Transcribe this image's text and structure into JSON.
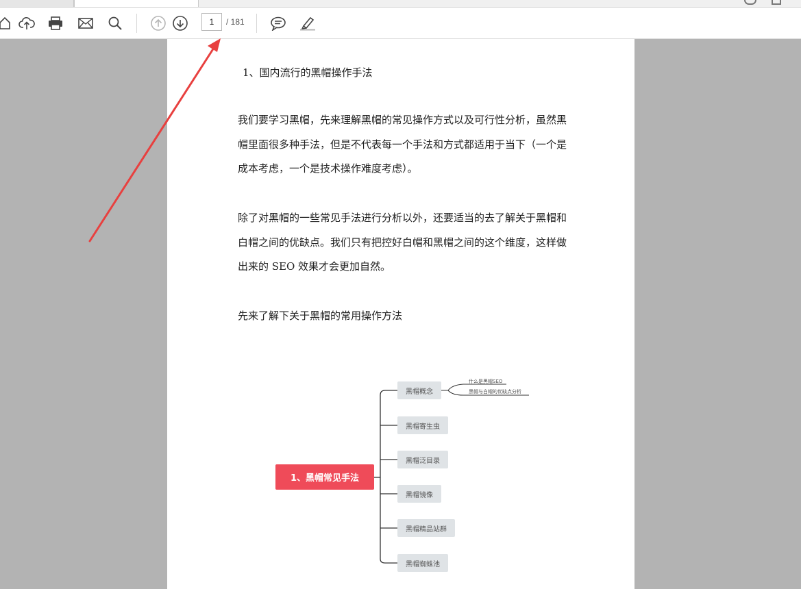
{
  "toolbar": {
    "page_input_value": "1",
    "page_total": "/ 181"
  },
  "document": {
    "heading": "1、国内流行的黑帽操作手法",
    "paragraphs": [
      "我们要学习黑帽，先来理解黑帽的常见操作方式以及可行性分析，虽然黑帽里面很多种手法，但是不代表每一个手法和方式都适用于当下（一个是成本考虑，一个是技术操作难度考虑）。",
      "除了对黑帽的一些常见手法进行分析以外，还要适当的去了解关于黑帽和白帽之间的优缺点。我们只有把控好白帽和黑帽之间的这个维度，这样做出来的 SEO 效果才会更加自然。",
      "先来了解下关于黑帽的常用操作方法"
    ]
  },
  "mindmap": {
    "root": "1、黑帽常见手法",
    "branches": [
      "黑帽概念",
      "黑帽寄生虫",
      "黑帽泛目录",
      "黑帽镜像",
      "黑帽精品站群",
      "黑帽蜘蛛池"
    ],
    "sub_items": [
      "什么是黑帽SEO",
      "黑帽与白帽的优缺点分析"
    ]
  },
  "colors": {
    "annotation_arrow": "#e8403f",
    "mindmap_root": "#ef4b59",
    "background": "#b3b3b3"
  }
}
